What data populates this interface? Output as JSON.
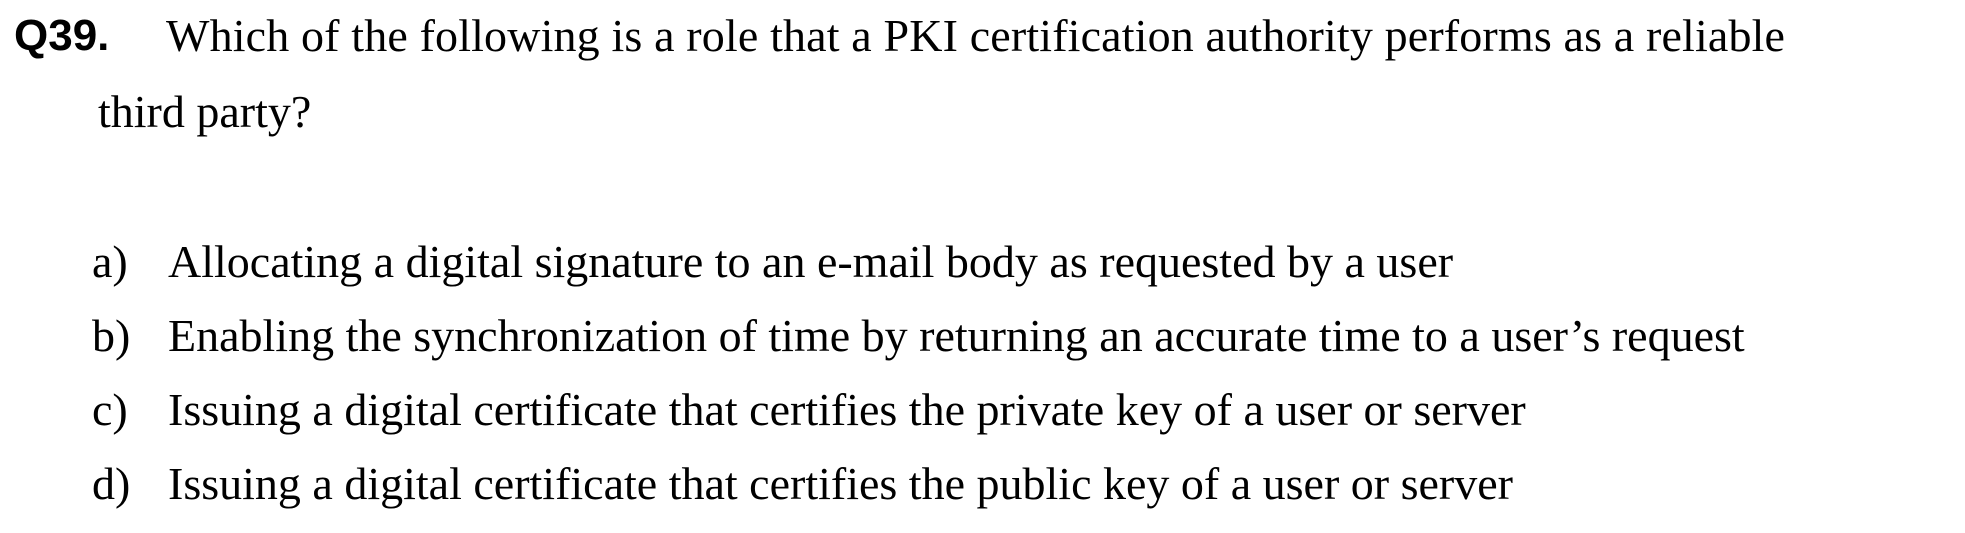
{
  "question": {
    "number": "Q39.",
    "text_line1": "Which of the following is a role that a PKI certification authority performs as a reliable",
    "text_line2": "third party?"
  },
  "options": [
    {
      "letter": "a)",
      "text": "Allocating a digital signature to an e-mail body as requested by a user"
    },
    {
      "letter": "b)",
      "text": "Enabling the synchronization of time by returning an accurate time to a user’s request"
    },
    {
      "letter": "c)",
      "text": "Issuing a digital certificate that certifies the private key of a user or server"
    },
    {
      "letter": "d)",
      "text": "Issuing a digital certificate that certifies the public key of a user or server"
    }
  ]
}
